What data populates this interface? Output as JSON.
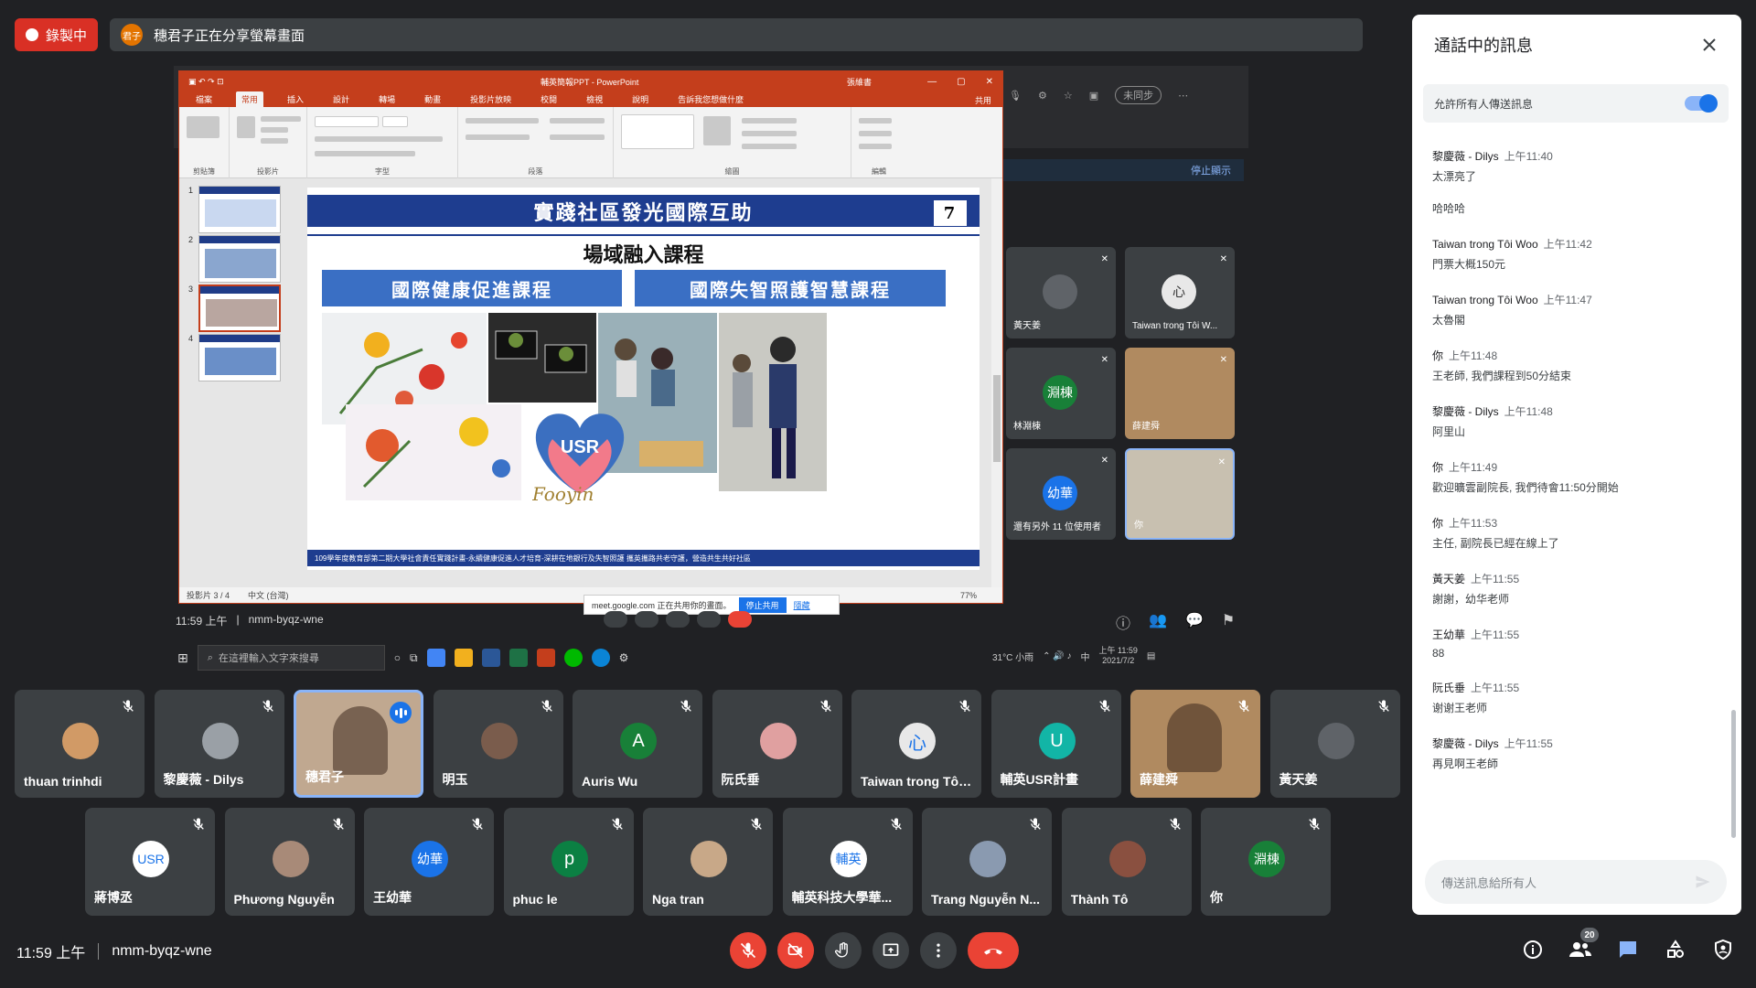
{
  "recording": {
    "label": "錄製中"
  },
  "presenting": {
    "avatar_text": "君子",
    "text": "穗君子正在分享螢幕畫面"
  },
  "ppt": {
    "title": "輔英簡報PPT - PowerPoint",
    "user": "張維書",
    "tabs": [
      "檔案",
      "常用",
      "插入",
      "設計",
      "轉場",
      "動畫",
      "投影片放映",
      "校閱",
      "檢視",
      "說明",
      "告訴我您想做什麼"
    ],
    "share_label": "共用",
    "ribbon_groups": [
      "剪貼簿",
      "投影片",
      "字型",
      "段落",
      "繪圖",
      "編輯"
    ],
    "status_left": "投影片 3 / 4",
    "status_lang": "中文 (台灣)",
    "zoom": "77%",
    "thumb_numbers": [
      "1",
      "2",
      "3",
      "4"
    ]
  },
  "slide": {
    "title": "實踐社區發光國際互助",
    "number": "7",
    "subtitle": "場域融入課程",
    "box_left": "國際健康促進課程",
    "box_right": "國際失智照護智慧課程",
    "logo_text": "USR",
    "brand_text": "Fooyin",
    "footer": "109學年度教育部第二期大學社會責任實踐計畫-永續健康促進人才培育-深耕在地銀行及失智照護 攜英攜路共老守護，營造共生共好社區"
  },
  "share_toast": {
    "text": "meet.google.com 正在共用你的畫面。",
    "stop": "停止共用",
    "hide": "隱藏"
  },
  "inner_meeting": {
    "time": "11:59 上午",
    "code": "nmm-byqz-wne",
    "stop_label": "停止顯示"
  },
  "taskbar": {
    "search_placeholder": "在這裡輸入文字來搜尋",
    "weather": "31°C 小雨",
    "ime": "中",
    "clock_time": "上午 11:59",
    "clock_date": "2021/7/2",
    "browser_btn": "未同步"
  },
  "inner_tiles": [
    {
      "name": "黃天姜",
      "avatar": "",
      "color": "#5f6368"
    },
    {
      "name": "Taiwan trong Tôi W...",
      "avatar": "心",
      "color": "#e8e8e8"
    },
    {
      "name": "林淵棟",
      "avatar": "淵棟",
      "color": "#188038"
    },
    {
      "name": "薛建舜",
      "avatar": "",
      "color": "#b08a60"
    },
    {
      "name": "還有另外 11 位使用者",
      "avatar": "幼華",
      "color": "#1a73e8"
    },
    {
      "name": "你",
      "avatar": "",
      "color": "#c8c0b0"
    }
  ],
  "participants_row1": [
    {
      "name": "thuan trinhdi",
      "avatar": "",
      "color": "#d19a66",
      "video": false
    },
    {
      "name": "黎慶薇 - Dilys",
      "avatar": "",
      "color": "#9aa0a6",
      "video": false
    },
    {
      "name": "穗君子",
      "avatar": "",
      "color": "#c0a890",
      "video": true
    },
    {
      "name": "明玉",
      "avatar": "",
      "color": "#7a5c4c",
      "video": false
    },
    {
      "name": "Auris Wu",
      "avatar": "A",
      "color": "#188038",
      "video": false
    },
    {
      "name": "阮氏垂",
      "avatar": "",
      "color": "#e0a0a0",
      "video": false
    },
    {
      "name": "Taiwan trong Tôi...",
      "avatar": "心",
      "color": "#e8e8e8",
      "video": false
    },
    {
      "name": "輔英USR計畫",
      "avatar": "U",
      "color": "#12b5a6",
      "video": false
    },
    {
      "name": "薛建舜",
      "avatar": "",
      "color": "#b08a60",
      "video": true
    },
    {
      "name": "黃天姜",
      "avatar": "",
      "color": "#5f6368",
      "video": false
    }
  ],
  "participants_row2": [
    {
      "name": "蔣博丞",
      "avatar": "USR",
      "color": "#ffffff"
    },
    {
      "name": "Phương Nguyễn",
      "avatar": "",
      "color": "#a88a78"
    },
    {
      "name": "王幼華",
      "avatar": "幼華",
      "color": "#1a73e8"
    },
    {
      "name": "phuc le",
      "avatar": "p",
      "color": "#0b8043"
    },
    {
      "name": "Nga tran",
      "avatar": "",
      "color": "#c8a888"
    },
    {
      "name": "輔英科技大學華...",
      "avatar": "輔英",
      "color": "#ffffff"
    },
    {
      "name": "Trang Nguyễn N...",
      "avatar": "",
      "color": "#8a9ab0"
    },
    {
      "name": "Thành Tô",
      "avatar": "",
      "color": "#8a5040"
    },
    {
      "name": "你",
      "avatar": "淵棟",
      "color": "#188038"
    }
  ],
  "bottom": {
    "time": "11:59 上午",
    "code": "nmm-byqz-wne",
    "participant_count": "20"
  },
  "chat": {
    "title": "通話中的訊息",
    "allow_label": "允許所有人傳送訊息",
    "input_placeholder": "傳送訊息給所有人",
    "messages": [
      {
        "sender": "黎慶薇 - Dilys",
        "time": "上午11:40",
        "lines": [
          "太漂亮了",
          "哈哈哈"
        ]
      },
      {
        "sender": "Taiwan trong Tôi Woo",
        "time": "上午11:42",
        "lines": [
          "門票大概150元"
        ]
      },
      {
        "sender": "Taiwan trong Tôi Woo",
        "time": "上午11:47",
        "lines": [
          "太魯閣"
        ]
      },
      {
        "sender": "你",
        "time": "上午11:48",
        "lines": [
          "王老師, 我們課程到50分結束"
        ]
      },
      {
        "sender": "黎慶薇 - Dilys",
        "time": "上午11:48",
        "lines": [
          "阿里山"
        ]
      },
      {
        "sender": "你",
        "time": "上午11:49",
        "lines": [
          "歡迎曠雲副院長, 我們待會11:50分開始"
        ]
      },
      {
        "sender": "你",
        "time": "上午11:53",
        "lines": [
          "主任, 副院長已經在線上了"
        ]
      },
      {
        "sender": "黃天姜",
        "time": "上午11:55",
        "lines": [
          "謝謝，幼华老师"
        ]
      },
      {
        "sender": "王幼華",
        "time": "上午11:55",
        "lines": [
          "88"
        ]
      },
      {
        "sender": "阮氏垂",
        "time": "上午11:55",
        "lines": [
          "谢谢王老师"
        ]
      },
      {
        "sender": "黎慶薇 - Dilys",
        "time": "上午11:55",
        "lines": [
          "再見啊王老師"
        ]
      }
    ]
  }
}
